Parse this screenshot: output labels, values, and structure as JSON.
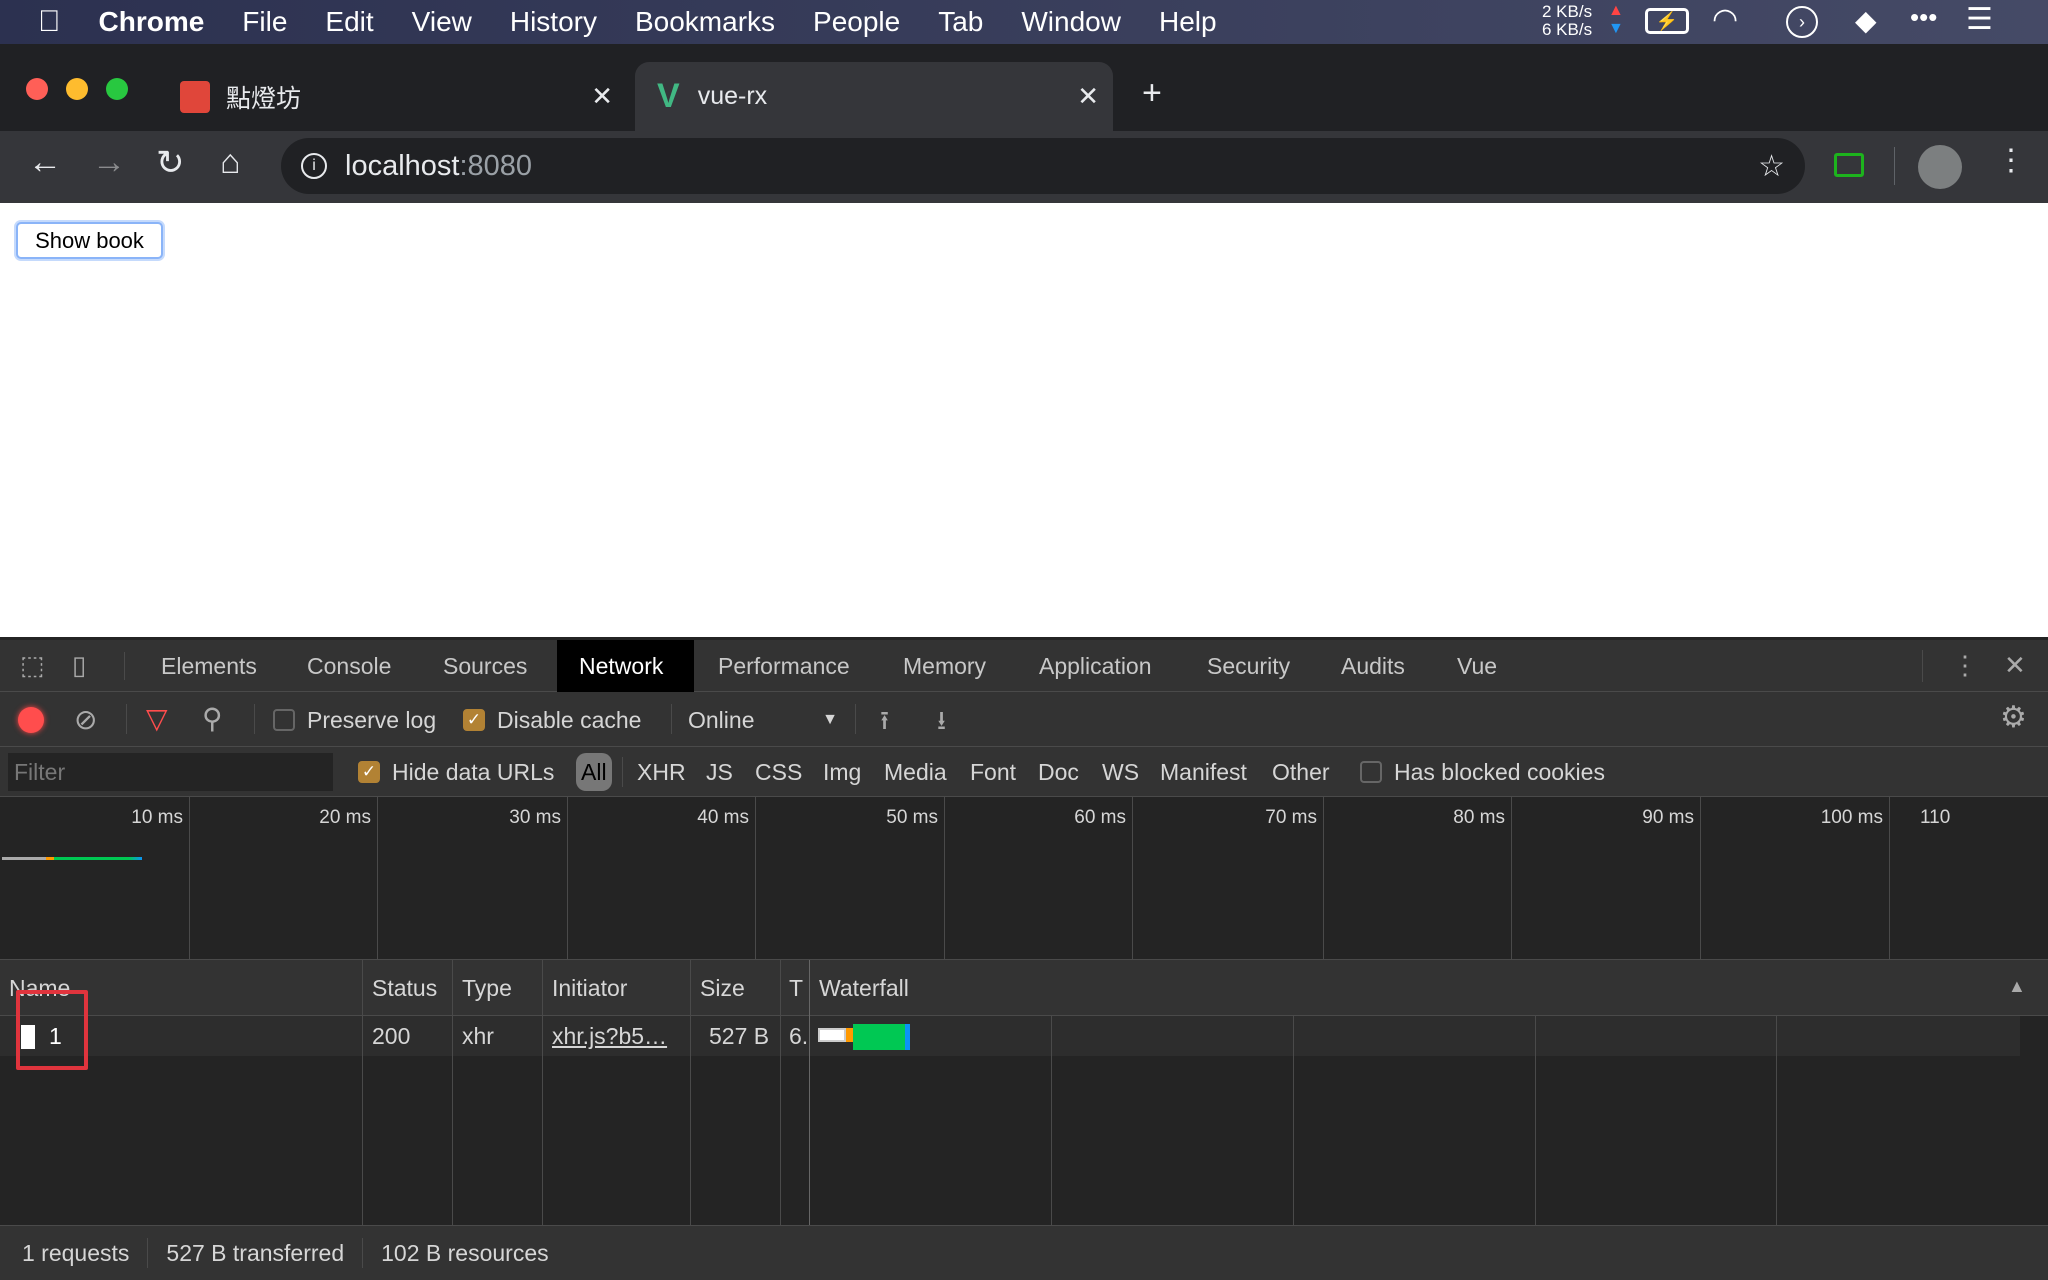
{
  "menubar": {
    "app": "Chrome",
    "items": [
      "File",
      "Edit",
      "View",
      "History",
      "Bookmarks",
      "People",
      "Tab",
      "Window",
      "Help"
    ],
    "net_up": "2 KB/s",
    "net_down": "6 KB/s"
  },
  "tabs": [
    {
      "title": "點燈坊",
      "active": false
    },
    {
      "title": "vue-rx",
      "active": true
    }
  ],
  "omnibox": {
    "host": "localhost",
    "port": ":8080"
  },
  "page": {
    "button": "Show book"
  },
  "devtools": {
    "tabs": [
      "Elements",
      "Console",
      "Sources",
      "Network",
      "Performance",
      "Memory",
      "Application",
      "Security",
      "Audits",
      "Vue"
    ],
    "selected_tab": "Network",
    "toolbar": {
      "preserve_log": "Preserve log",
      "preserve_log_checked": false,
      "disable_cache": "Disable cache",
      "disable_cache_checked": true,
      "throttle": "Online"
    },
    "filter": {
      "placeholder": "Filter",
      "hide_data_urls": "Hide data URLs",
      "hide_data_urls_checked": true,
      "types": [
        "All",
        "XHR",
        "JS",
        "CSS",
        "Img",
        "Media",
        "Font",
        "Doc",
        "WS",
        "Manifest",
        "Other"
      ],
      "selected_type": "All",
      "has_blocked_cookies": "Has blocked cookies"
    },
    "overview_ticks": [
      "10 ms",
      "20 ms",
      "30 ms",
      "40 ms",
      "50 ms",
      "60 ms",
      "70 ms",
      "80 ms",
      "90 ms",
      "100 ms",
      "110"
    ],
    "columns": [
      "Name",
      "Status",
      "Type",
      "Initiator",
      "Size",
      "T",
      "Waterfall"
    ],
    "rows": [
      {
        "name": "1",
        "status": "200",
        "type": "xhr",
        "initiator": "xhr.js?b5…",
        "size": "527 B",
        "time": "6."
      }
    ],
    "summary": {
      "requests": "1 requests",
      "transferred": "527 B transferred",
      "resources": "102 B resources"
    }
  },
  "colors": {
    "record": "#ff4d4d",
    "checkbox": "#b28234",
    "highlight_box": "#e0343d",
    "waterfall_waiting": "#00c853",
    "waterfall_download": "#0b93f6"
  }
}
